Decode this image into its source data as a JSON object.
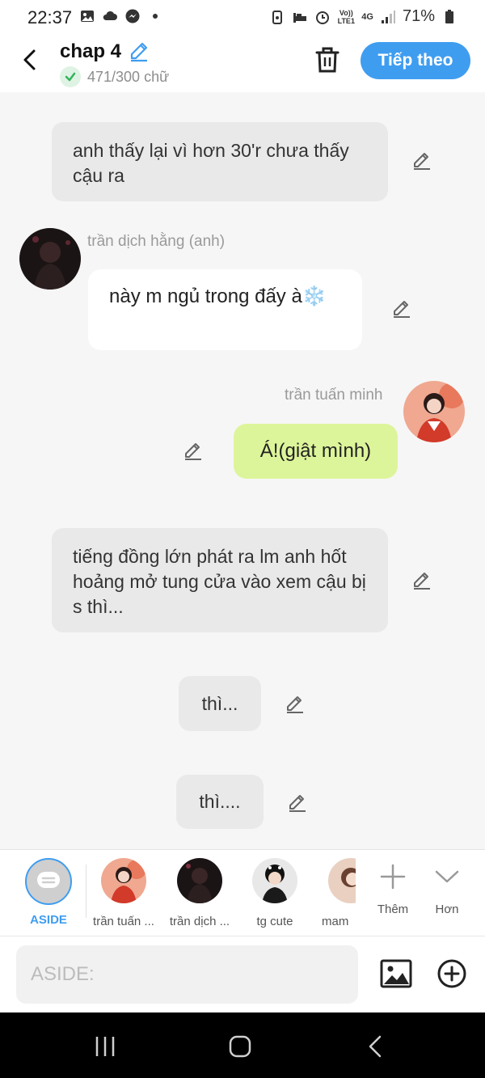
{
  "status_bar": {
    "time": "22:37",
    "battery": "71%",
    "network": "4G",
    "volte": "Vo)) LTE1"
  },
  "header": {
    "title": "chap 4",
    "word_count": "471/300 chữ",
    "next_label": "Tiếp theo",
    "accent_color": "#3f9df0"
  },
  "messages": {
    "narration_1": "anh thấy lại vì hơn 30'r chưa thấy cậu ra",
    "left_sender": "trần dịch hằng (anh)",
    "left_text": "này m ngủ trong đấy à❄️",
    "right_sender": "trần tuấn minh",
    "right_text": "Á!(giật mình)",
    "narration_2": "tiếng đồng lớn phát ra lm anh hốt hoảng mở tung cửa vào xem cậu bị s thì...",
    "small_1": "thì...",
    "small_2": "thì...."
  },
  "characters": {
    "aside": "ASIDE",
    "items": [
      "trần tuấn ...",
      "trần dịch ...",
      "tg cute",
      "mam"
    ],
    "more": "Thêm",
    "collapse": "Hơn"
  },
  "input": {
    "placeholder": "ASIDE:"
  }
}
